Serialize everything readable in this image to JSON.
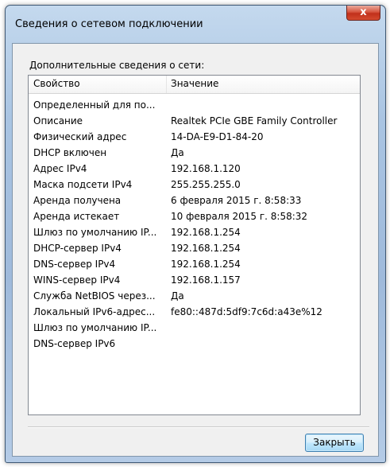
{
  "window": {
    "title": "Сведения о сетевом подключении",
    "close_glyph": "x"
  },
  "section_label": "Дополнительные сведения о сети:",
  "columns": {
    "property": "Свойство",
    "value": "Значение"
  },
  "rows": [
    {
      "property": "Определенный для по...",
      "value": ""
    },
    {
      "property": "Описание",
      "value": "Realtek PCIe GBE Family Controller"
    },
    {
      "property": "Физический адрес",
      "value": "14-DA-E9-D1-84-20"
    },
    {
      "property": "DHCP включен",
      "value": "Да"
    },
    {
      "property": "Адрес IPv4",
      "value": "192.168.1.120"
    },
    {
      "property": "Маска подсети IPv4",
      "value": "255.255.255.0"
    },
    {
      "property": "Аренда получена",
      "value": "6 февраля 2015 г. 8:58:33"
    },
    {
      "property": "Аренда истекает",
      "value": "10 февраля 2015 г. 8:58:32"
    },
    {
      "property": "Шлюз по умолчанию IP...",
      "value": "192.168.1.254"
    },
    {
      "property": "DHCP-сервер IPv4",
      "value": "192.168.1.254"
    },
    {
      "property": "DNS-сервер IPv4",
      "value": "192.168.1.254"
    },
    {
      "property": "WINS-сервер IPv4",
      "value": "192.168.1.157"
    },
    {
      "property": "Служба NetBIOS через...",
      "value": "Да"
    },
    {
      "property": "Локальный IPv6-адрес...",
      "value": "fe80::487d:5df9:7c6d:a43e%12"
    },
    {
      "property": "Шлюз по умолчанию IP...",
      "value": ""
    },
    {
      "property": "DNS-сервер IPv6",
      "value": ""
    }
  ],
  "buttons": {
    "close_label": "Закрыть"
  }
}
